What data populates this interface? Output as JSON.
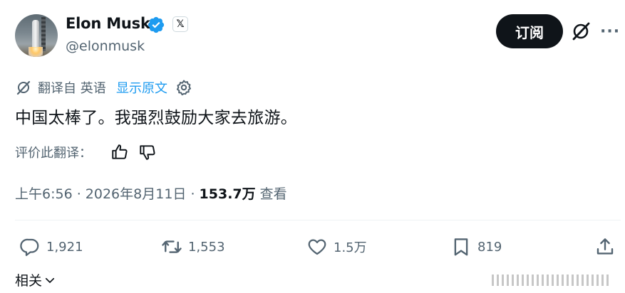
{
  "header": {
    "name": "Elon Musk",
    "handle": "@elonmusk",
    "subscribe_label": "订阅",
    "x_badge": "𝕏",
    "more_label": "···"
  },
  "translation": {
    "from_label": "翻译自 英语",
    "show_original": "显示原文"
  },
  "tweet": {
    "text": "中国太棒了。我强烈鼓励大家去旅游。"
  },
  "rating": {
    "label": "评价此翻译："
  },
  "meta": {
    "time": "上午6:56 · 2026年8月11日 · ",
    "views_count": "153.7万",
    "views_label": " 查看"
  },
  "actions": {
    "replies": "1,921",
    "retweets": "1,553",
    "likes": "1.5万",
    "bookmarks": "819"
  },
  "related": {
    "label": "相关"
  },
  "colors": {
    "accent": "#1d9bf0",
    "secondary_text": "#536471",
    "primary_text": "#0f1419"
  }
}
